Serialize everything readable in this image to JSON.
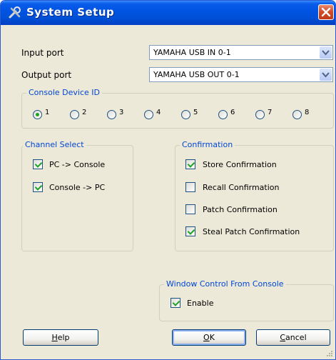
{
  "window": {
    "title": "System Setup",
    "accent_color": "#0054e3",
    "close_color": "#d04a26"
  },
  "ports": {
    "input_label": "Input port",
    "input_value": "YAMAHA USB IN 0-1",
    "output_label": "Output port",
    "output_value": "YAMAHA USB OUT 0-1"
  },
  "console_device_id": {
    "title": "Console Device ID",
    "options": [
      "1",
      "2",
      "3",
      "4",
      "5",
      "6",
      "7",
      "8"
    ],
    "selected": "1"
  },
  "channel_select": {
    "title": "Channel Select",
    "items": [
      {
        "label": "PC -> Console",
        "checked": true
      },
      {
        "label": "Console -> PC",
        "checked": true
      }
    ]
  },
  "confirmation": {
    "title": "Confirmation",
    "items": [
      {
        "label": "Store Confirmation",
        "checked": true
      },
      {
        "label": "Recall Confirmation",
        "checked": false
      },
      {
        "label": "Patch Confirmation",
        "checked": false
      },
      {
        "label": "Steal Patch Confirmation",
        "checked": true
      }
    ]
  },
  "window_control": {
    "title": "Window Control From Console",
    "enable_label": "Enable",
    "enable_checked": true
  },
  "buttons": {
    "help_mnemonic": "H",
    "help_rest": "elp",
    "ok_mnemonic": "O",
    "ok_rest": "K",
    "cancel_mnemonic": "C",
    "cancel_rest": "ancel"
  }
}
